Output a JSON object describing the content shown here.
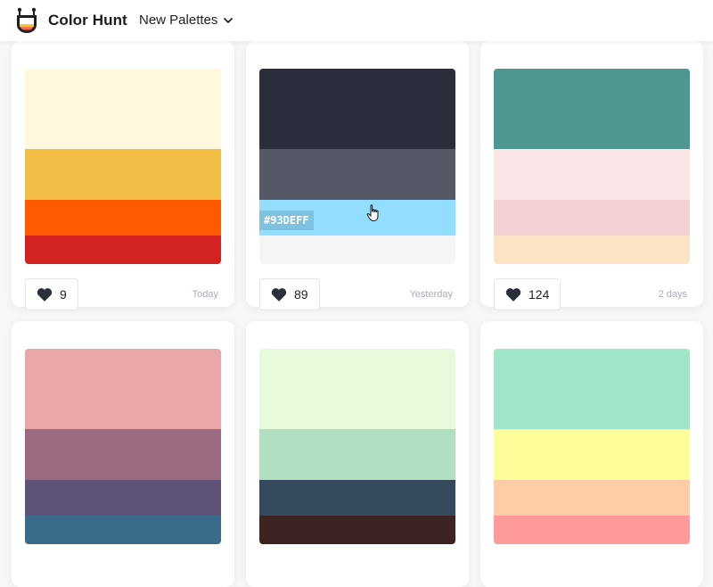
{
  "header": {
    "brand": "Color Hunt",
    "nav_label": "New Palettes",
    "icons": {
      "logo": "color-hunt-logo-icon",
      "dropdown": "chevron-down-icon"
    }
  },
  "palettes": [
    {
      "colors": [
        "#FFF8DC",
        "#F2BE45",
        "#FF5A00",
        "#D32222"
      ],
      "likes": "9",
      "date": "Today"
    },
    {
      "colors": [
        "#2B2E3A",
        "#555865",
        "#93DEFF",
        "#F5F5F5"
      ],
      "likes": "89",
      "date": "Yesterday",
      "hover_hex": "#93DEFF"
    },
    {
      "colors": [
        "#4E9690",
        "#FAE6E6",
        "#F2D1D4",
        "#FBE5C6"
      ],
      "likes": "124",
      "date": "2 days"
    },
    {
      "colors": [
        "#E9A6A7",
        "#9C6A80",
        "#5F5378",
        "#3A6B8A"
      ]
    },
    {
      "colors": [
        "#E5F9DB",
        "#B1E0C1",
        "#35495C",
        "#3D2422"
      ]
    },
    {
      "colors": [
        "#A0E5C9",
        "#FDFD9A",
        "#FECDA8",
        "#FF9A9A"
      ]
    }
  ],
  "icons": {
    "heart": "heart-icon",
    "cursor": "hand-cursor-icon"
  }
}
